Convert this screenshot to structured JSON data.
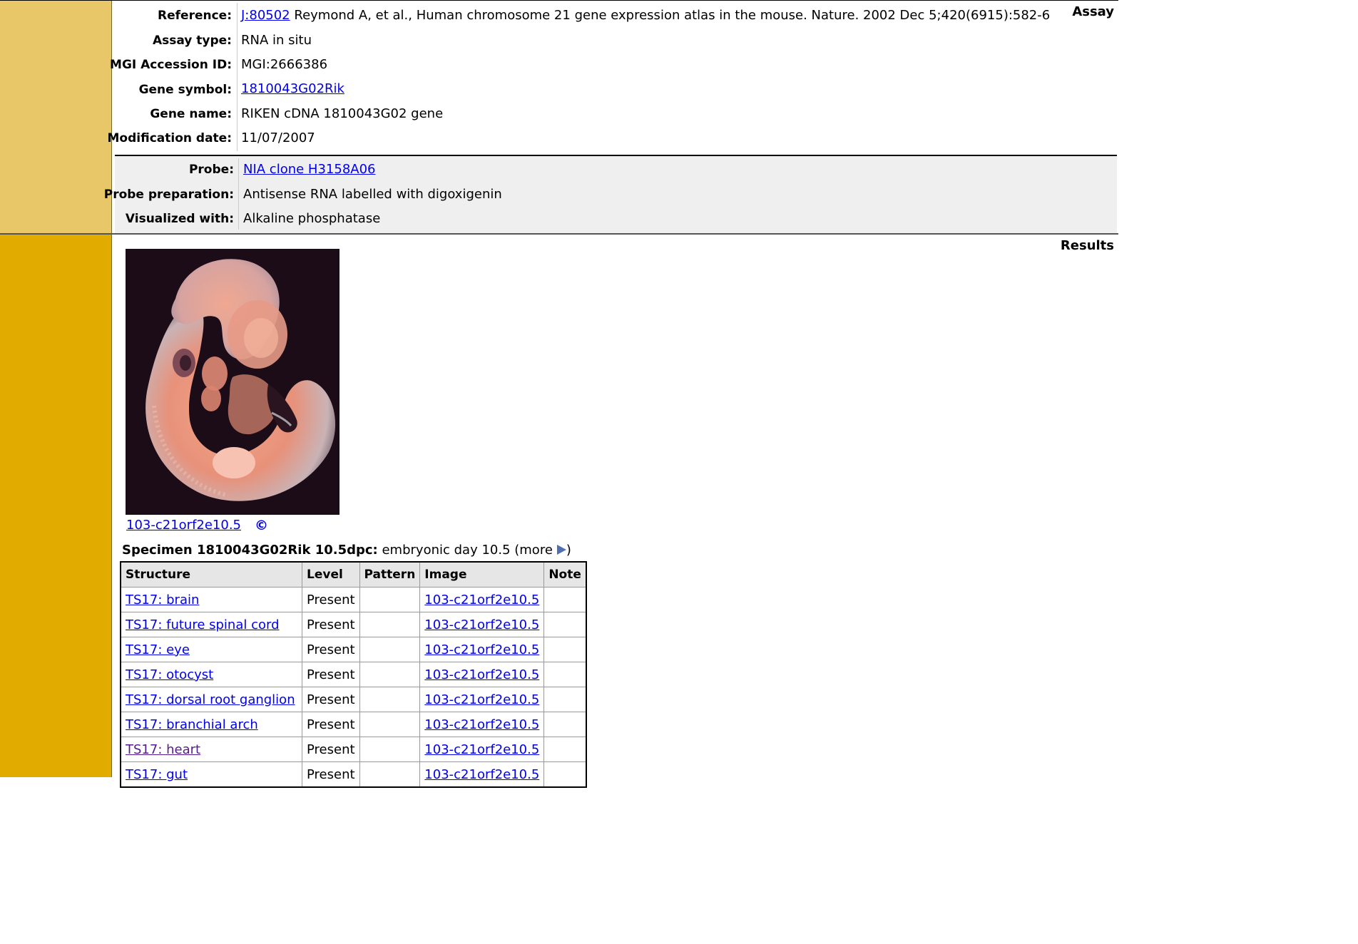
{
  "sections": {
    "assay_title": "Assay",
    "results_title": "Results"
  },
  "assay": {
    "reference_label": "Reference:",
    "reference_link": "J:80502",
    "reference_text": "Reymond A, et al., Human chromosome 21 gene expression atlas in the mouse. Nature. 2002 Dec 5;420(6915):582-6",
    "assay_type_label": "Assay type:",
    "assay_type": "RNA in situ",
    "accession_label": "MGI Accession ID:",
    "accession": "MGI:2666386",
    "gene_symbol_label": "Gene symbol:",
    "gene_symbol": "1810043G02Rik",
    "gene_name_label": "Gene name:",
    "gene_name": "RIKEN cDNA 1810043G02 gene",
    "mod_date_label": "Modification date:",
    "mod_date": "11/07/2007"
  },
  "probe": {
    "probe_label": "Probe:",
    "probe": "NIA clone H3158A06",
    "prep_label": "Probe preparation:",
    "prep": "Antisense RNA labelled with digoxigenin",
    "visualized_label": "Visualized with:",
    "visualized": "Alkaline phosphatase"
  },
  "image": {
    "caption": "103-c21orf2e10.5",
    "copyright_symbol": "©"
  },
  "specimen": {
    "title": "Specimen 1810043G02Rik 10.5dpc:",
    "description": " embryonic day 10.5 (more",
    "close": ")"
  },
  "table": {
    "headers": [
      "Structure",
      "Level",
      "Pattern",
      "Image",
      "Note"
    ],
    "rows": [
      {
        "structure": "TS17: brain",
        "level": "Present",
        "pattern": "",
        "image": "103-c21orf2e10.5",
        "note": ""
      },
      {
        "structure": "TS17: future spinal cord",
        "level": "Present",
        "pattern": "",
        "image": "103-c21orf2e10.5",
        "note": ""
      },
      {
        "structure": "TS17: eye",
        "level": "Present",
        "pattern": "",
        "image": "103-c21orf2e10.5",
        "note": ""
      },
      {
        "structure": "TS17: otocyst",
        "level": "Present",
        "pattern": "",
        "image": "103-c21orf2e10.5",
        "note": ""
      },
      {
        "structure": "TS17: dorsal root ganglion",
        "level": "Present",
        "pattern": "",
        "image": "103-c21orf2e10.5",
        "note": ""
      },
      {
        "structure": "TS17: branchial arch",
        "level": "Present",
        "pattern": "",
        "image": "103-c21orf2e10.5",
        "note": ""
      },
      {
        "structure": "TS17: heart",
        "level": "Present",
        "pattern": "",
        "image": "103-c21orf2e10.5",
        "note": ""
      },
      {
        "structure": "TS17: gut",
        "level": "Present",
        "pattern": "",
        "image": "103-c21orf2e10.5",
        "note": ""
      }
    ]
  }
}
